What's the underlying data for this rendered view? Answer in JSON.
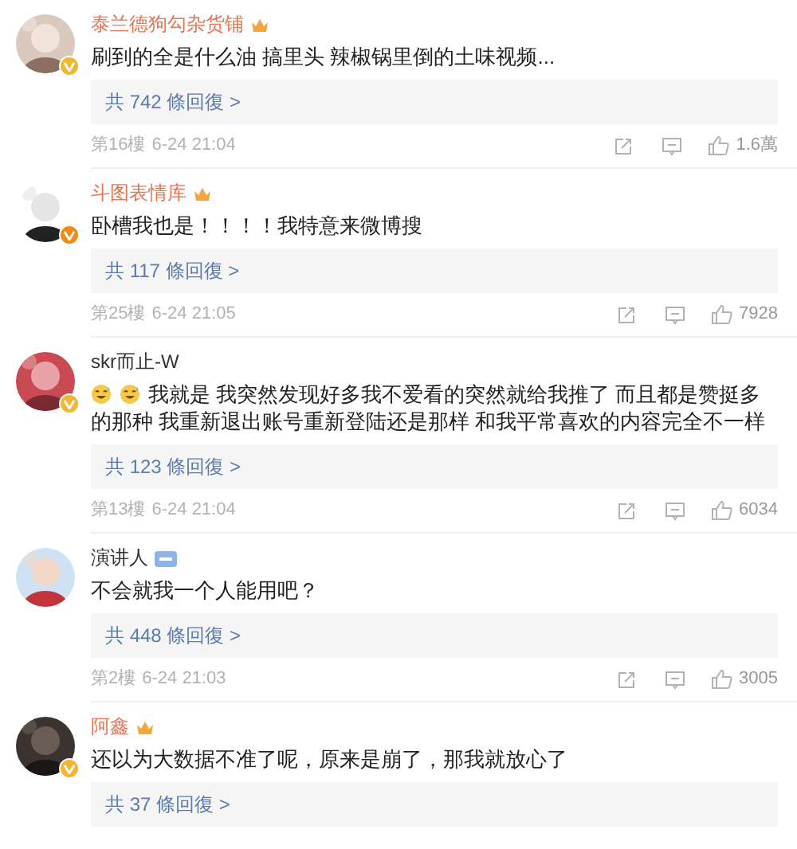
{
  "comments": [
    {
      "name": "泰兰德狗勾杂货铺",
      "vip": true,
      "crown": true,
      "member_badge": false,
      "verified": true,
      "text": "刷到的全是什么油 搞里头 辣椒锅里倒的土味视频...",
      "replies": "共 742 條回復 >",
      "meta": {
        "floor": "第16樓",
        "time": "6-24 21:04",
        "likes": "1.6萬"
      }
    },
    {
      "name": "斗图表情库",
      "vip": true,
      "crown": true,
      "member_badge": false,
      "verified": true,
      "text": "卧槽我也是！！！！我特意来微博搜",
      "replies": "共 117 條回復 >",
      "meta": {
        "floor": "第25樓",
        "time": "6-24 21:05",
        "likes": "7928"
      }
    },
    {
      "name": "skr而止-W",
      "vip": false,
      "crown": false,
      "member_badge": false,
      "verified": true,
      "emojis": [
        {
          "kind": "sweat-smile"
        },
        {
          "kind": "sweat-smile"
        }
      ],
      "text": "我就是 我突然发现好多我不爱看的突然就给我推了 而且都是赞挺多的那种 我重新退出账号重新登陆还是那样 和我平常喜欢的内容完全不一样",
      "replies": "共 123 條回復 >",
      "meta": {
        "floor": "第13樓",
        "time": "6-24 21:04",
        "likes": "6034"
      }
    },
    {
      "name": "演讲人",
      "vip": false,
      "crown": false,
      "member_badge": true,
      "verified": false,
      "text": "不会就我一个人能用吧？",
      "replies": "共 448 條回復 >",
      "meta": {
        "floor": "第2樓",
        "time": "6-24 21:03",
        "likes": "3005"
      }
    },
    {
      "name": "阿鑫",
      "vip": true,
      "crown": true,
      "member_badge": false,
      "verified": true,
      "text": "还以为大数据不准了呢，原来是崩了，那我就放心了",
      "replies": "共 37 條回復 >"
    }
  ]
}
